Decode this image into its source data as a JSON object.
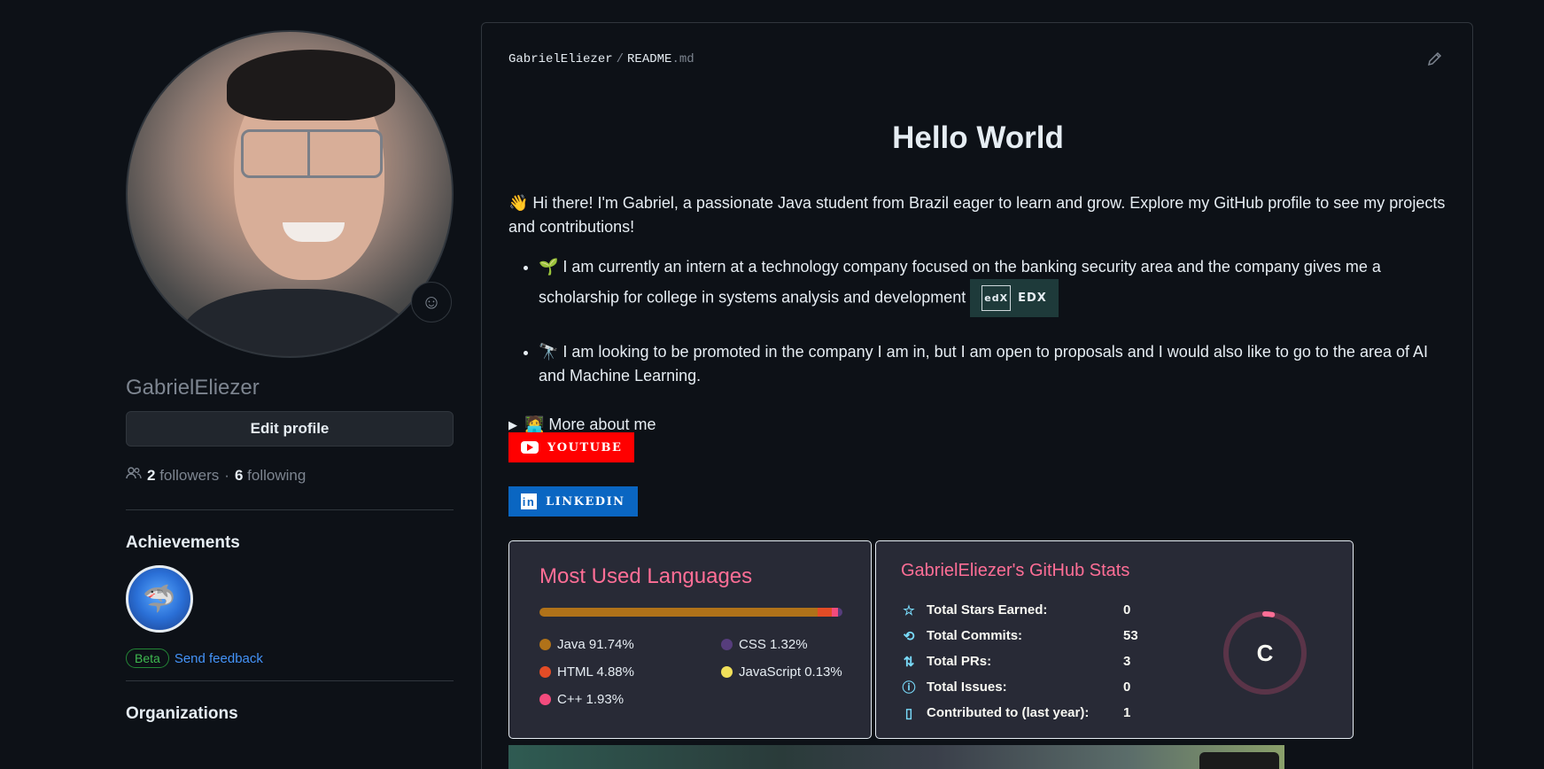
{
  "profile": {
    "username": "GabrielEliezer",
    "edit_label": "Edit profile",
    "followers_count": "2",
    "followers_label": "followers",
    "dot_sep": "·",
    "following_count": "6",
    "following_label": "following"
  },
  "achievements": {
    "heading": "Achievements",
    "beta_label": "Beta",
    "feedback_label": "Send feedback"
  },
  "organizations": {
    "heading": "Organizations"
  },
  "readme": {
    "owner": "GabrielEliezer",
    "slash": "/",
    "file": "README",
    "ext": ".md",
    "title": "Hello World",
    "intro": "👋 Hi there! I'm Gabriel, a passionate Java student from Brazil eager to learn and grow. Explore my GitHub profile to see my projects and contributions!",
    "bullets": [
      "🌱 I am currently an intern at a technology company focused on the banking security area and the company gives me a scholarship for college in systems analysis and development",
      "🔭 I am looking to be promoted in the company I am in, but I am open to proposals and I would also like to go to the area of AI and Machine Learning."
    ],
    "edx_label": "EDX",
    "edx_icon_text": "edX",
    "more_label": "🧑‍💻 More about me",
    "youtube_label": "YOUTUBE",
    "linkedin_label": "LINKEDIN",
    "linkedin_icon_text": "in"
  },
  "languages_card": {
    "title": "Most Used Languages",
    "languages": [
      {
        "name": "Java",
        "percent": 91.74,
        "label": "Java 91.74%",
        "color": "#b07219"
      },
      {
        "name": "CSS",
        "percent": 1.32,
        "label": "CSS 1.32%",
        "color": "#563d7c"
      },
      {
        "name": "HTML",
        "percent": 4.88,
        "label": "HTML 4.88%",
        "color": "#e34c26"
      },
      {
        "name": "JavaScript",
        "percent": 0.13,
        "label": "JavaScript 0.13%",
        "color": "#f1e05a"
      },
      {
        "name": "C++",
        "percent": 1.93,
        "label": "C++ 1.93%",
        "color": "#f34b7d"
      }
    ]
  },
  "stats_card": {
    "title": "GabrielEliezer's GitHub Stats",
    "rows": [
      {
        "icon": "star-icon",
        "glyph": "☆",
        "label": "Total Stars Earned:",
        "value": "0"
      },
      {
        "icon": "history-icon",
        "glyph": "⟲",
        "label": "Total Commits:",
        "value": "53"
      },
      {
        "icon": "pull-request-icon",
        "glyph": "⇅",
        "label": "Total PRs:",
        "value": "3"
      },
      {
        "icon": "issue-icon",
        "glyph": "ⓘ",
        "label": "Total Issues:",
        "value": "0"
      },
      {
        "icon": "repo-icon",
        "glyph": "▯",
        "label": "Contributed to (last year):",
        "value": "1"
      }
    ],
    "grade": "C",
    "ring_progress": 0.03,
    "ring_color": "#ff6e96"
  },
  "colors": {
    "background": "#0d1117",
    "card_bg": "#282a36",
    "title_pink": "#ff6e96",
    "link_blue": "#4493f8",
    "youtube_red": "#ff0000",
    "linkedin_blue": "#0a66c2"
  }
}
